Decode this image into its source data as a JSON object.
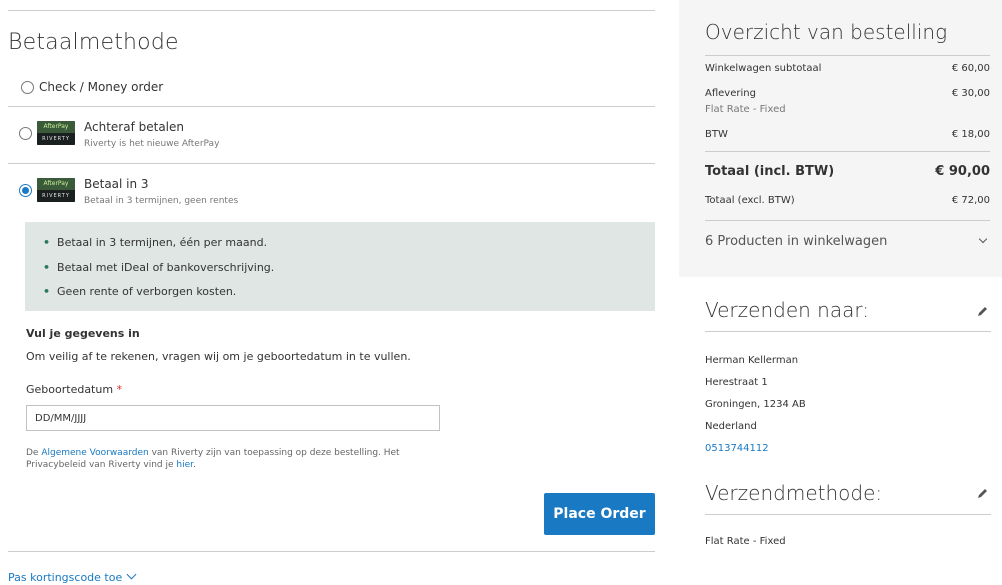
{
  "payment": {
    "title": "Betaalmethode",
    "methods": [
      {
        "label": "Check / Money order",
        "sub": ""
      },
      {
        "label": "Achteraf betalen",
        "sub": "Riverty is het nieuwe AfterPay"
      },
      {
        "label": "Betaal in 3",
        "sub": "Betaal in 3 termijnen, geen rentes"
      }
    ],
    "logo_top": "AfterPay",
    "logo_bottom": "RIVERTY",
    "benefits": [
      "Betaal in 3 termijnen, één per maand.",
      "Betaal met iDeal of bankoverschrijving.",
      "Geen rente of verborgen kosten."
    ],
    "form_heading": "Vul je gegevens in",
    "form_desc": "Om veilig af te rekenen, vragen wij om je geboortedatum in te vullen.",
    "dob_label": "Geboortedatum",
    "dob_required": "*",
    "dob_value": "DD/MM/JJJJ",
    "terms_pre": "De ",
    "terms_link": "Algemene Voorwaarden",
    "terms_mid": " van Riverty zijn van toepassing op deze bestelling. Het Privacybeleid van Riverty vind je ",
    "terms_link2": "hier",
    "terms_end": ".",
    "place_order": "Place Order",
    "discount": "Pas kortingscode toe"
  },
  "summary": {
    "title": "Overzicht van bestelling",
    "subtotal_label": "Winkelwagen subtotaal",
    "subtotal_value": "€ 60,00",
    "shipping_label": "Aflevering",
    "shipping_sub": "Flat Rate - Fixed",
    "shipping_value": "€ 30,00",
    "tax_label": "BTW",
    "tax_value": "€ 18,00",
    "total_incl_label": "Totaal (incl. BTW)",
    "total_incl_value": "€ 90,00",
    "total_excl_label": "Totaal (excl. BTW)",
    "total_excl_value": "€ 72,00",
    "products_label": "6 Producten in winkelwagen"
  },
  "ship_to": {
    "title": "Verzenden naar:",
    "name": "Herman Kellerman",
    "street": "Herestraat 1",
    "city": "Groningen, 1234 AB",
    "country": "Nederland",
    "phone": "0513744112"
  },
  "ship_method": {
    "title": "Verzendmethode:",
    "value": "Flat Rate - Fixed"
  },
  "colors": {
    "accent": "#1979c3",
    "info_bg": "#dfe6e4",
    "summary_bg": "#f5f5f5"
  }
}
